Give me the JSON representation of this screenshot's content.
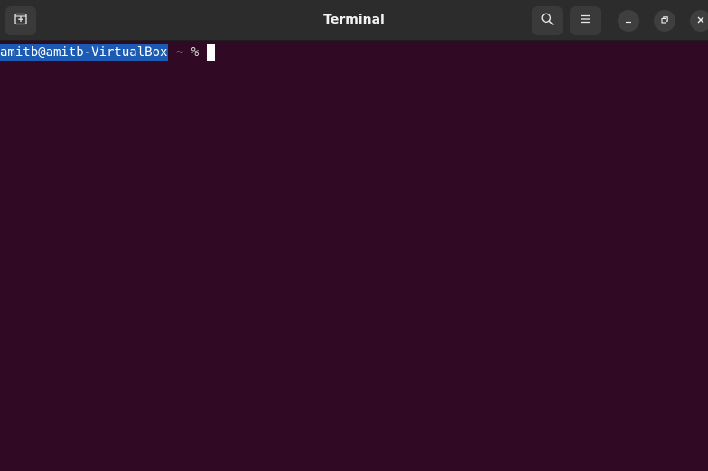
{
  "window": {
    "title": "Terminal"
  },
  "headerbar": {
    "new_tab_icon": "new-tab-icon",
    "search_icon": "search-icon",
    "menu_icon": "hamburger-menu-icon",
    "minimize_icon": "minimize-icon",
    "maximize_icon": "restore-icon",
    "close_icon": "close-icon"
  },
  "terminal": {
    "user_host": "amitb@amitb-VirtualBox",
    "prompt_suffix": " ~ % ",
    "colors": {
      "background": "#300a24",
      "selection": "#1b5bb4",
      "text": "#dcdcdc",
      "cursor": "#ffffff"
    }
  }
}
